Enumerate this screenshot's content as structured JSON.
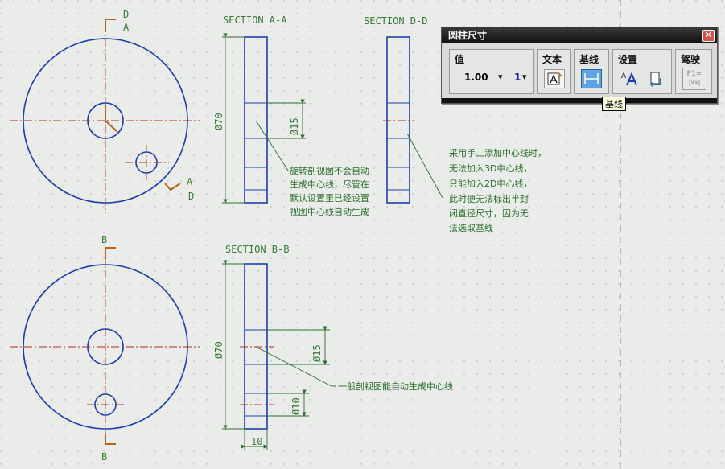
{
  "drawing": {
    "section_aa_title": "SECTION A-A",
    "section_dd_title": "SECTION D-D",
    "section_bb_title": "SECTION B-B",
    "cut_labels": {
      "top_d": "D",
      "top_a": "A",
      "right_a": "A",
      "right_d": "D",
      "b_top": "B",
      "b_bottom": "B"
    },
    "dims": {
      "aa_dia70": "Ø70",
      "aa_dia15": "Ø15",
      "bb_dia70": "Ø70",
      "bb_dia15": "Ø15",
      "bb_dia10": "Ø10",
      "bb_width": "10"
    },
    "notes": {
      "note1": [
        "旋转剖视图不会自动",
        "生成中心线，尽管在",
        "默认设置里已经设置",
        "视图中心线自动生成"
      ],
      "note2": [
        "采用手工添加中心线时，",
        "无法加入3D中心线，",
        "只能加入2D中心线，",
        "此时便无法标出半封",
        "闭直径尺寸，因为无",
        "法选取基线"
      ],
      "note3": "一般剖视图能自动生成中心线"
    }
  },
  "toolbar": {
    "title": "圆柱尺寸",
    "close_icon": "close-icon",
    "group_value_label": "值",
    "value_text": "1.00",
    "value_dropdown": "▾",
    "precision_text": "1",
    "precision_dropdown": "▾",
    "group_text_label": "文本",
    "group_baseline_label": "基线",
    "group_settings_label": "设置",
    "group_drive_label": "驾驶",
    "drive_button_text_1": "P1=",
    "drive_button_text_2": "|xx|"
  },
  "tooltip": {
    "text": "基线"
  },
  "colors": {
    "outline": "#1f3fa8",
    "centerline": "#b03020",
    "dimension": "#2e6e2e",
    "cutting_plane": "#b8641a",
    "background": "#e9ece9"
  }
}
